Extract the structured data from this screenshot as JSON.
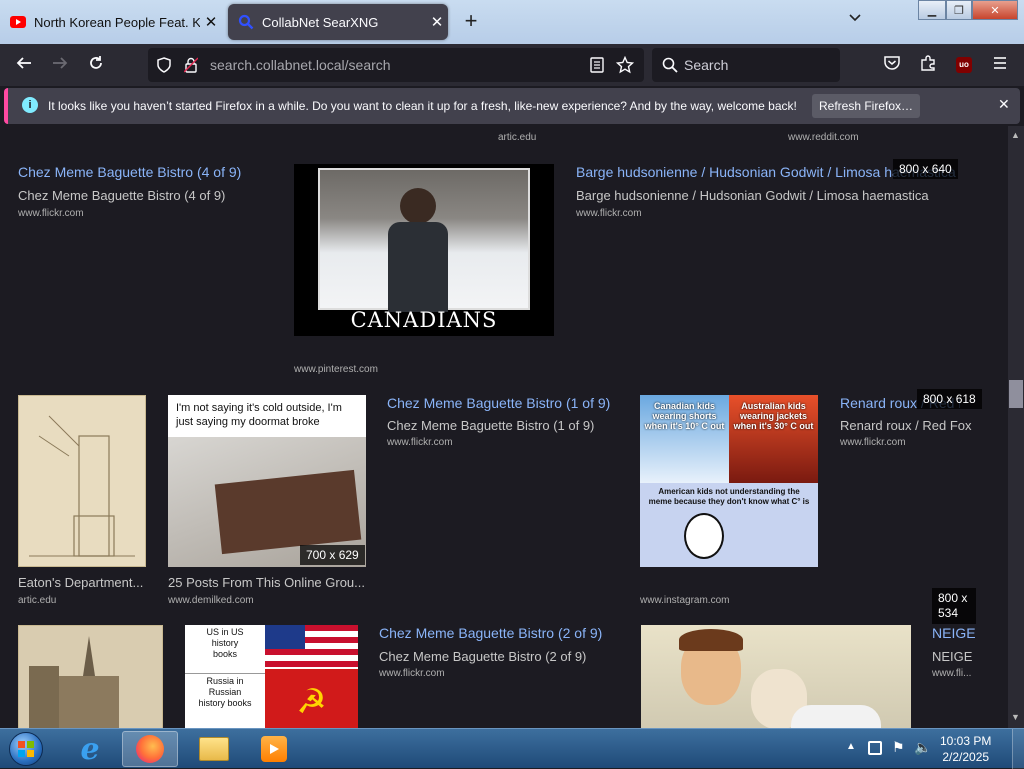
{
  "tabs": [
    {
      "label": "North Korean People Feat. Kim",
      "icon": "youtube-icon",
      "active": false
    },
    {
      "label": "CollabNet SearXNG",
      "icon": "searxng-icon",
      "active": true
    }
  ],
  "toolbar": {
    "url_host": "search.collabnet.local",
    "url_path": "/search",
    "search_placeholder": "Search",
    "ublock_badge": "uo"
  },
  "notification": {
    "message": "It looks like you haven’t started Firefox in a while. Do you want to clean it up for a fresh, like-new experience? And by the way, welcome back!",
    "button": "Refresh Firefox…"
  },
  "top_domains": [
    "artic.edu",
    "www.reddit.com"
  ],
  "row1": [
    {
      "title": "Chez Meme Baguette Bistro (4 of 9)",
      "subtitle": "Chez Meme Baguette Bistro (4 of 9)",
      "domain": "www.flickr.com"
    },
    {
      "image_caption": "CANADIANS",
      "domain": "www.pinterest.com"
    },
    {
      "title": "Barge hudsonienne / Hudsonian Godwit / Limosa haemastica",
      "subtitle": "Barge hudsonienne / Hudsonian Godwit / Limosa haemastica",
      "domain": "www.flickr.com",
      "resolution": "800 x 640"
    }
  ],
  "row2": [
    {
      "title": "Eaton's Department...",
      "domain": "artic.edu"
    },
    {
      "title": "25 Posts From This Online Grou...",
      "domain": "www.demilked.com",
      "resolution": "700 x 629",
      "meme_text": "I'm not saying it's cold outside, I'm just saying my doormat broke"
    },
    {
      "title": "Chez Meme Baguette Bistro (1 of 9)",
      "subtitle": "Chez Meme Baguette Bistro (1 of 9)",
      "domain": "www.flickr.com"
    },
    {
      "domain": "www.instagram.com",
      "meme_left": "Canadian kids wearing shorts when it's 10° C out",
      "meme_right": "Australian kids wearing jackets when it's 30° C out",
      "meme_bottom": "American kids not understanding the meme because they don't know what C° is"
    },
    {
      "title": "Renard roux / Red Fox",
      "subtitle": "Renard roux / Red Fox",
      "domain": "www.flickr.com",
      "resolution": "800 x 618"
    }
  ],
  "row3": [
    {
      "meme_top": "US in US history books",
      "meme_bottom": "Russia in Russian history books"
    },
    {
      "title": "Chez Meme Baguette Bistro (2 of 9)",
      "subtitle": "Chez Meme Baguette Bistro (2 of 9)",
      "domain": "www.flickr.com"
    },
    {
      "title": "NEIGE",
      "subtitle": "NEIGE",
      "domain": "www.fli...",
      "resolution": "800 x 534"
    }
  ],
  "taskbar": {
    "time": "10:03 PM",
    "date": "2/2/2025"
  }
}
